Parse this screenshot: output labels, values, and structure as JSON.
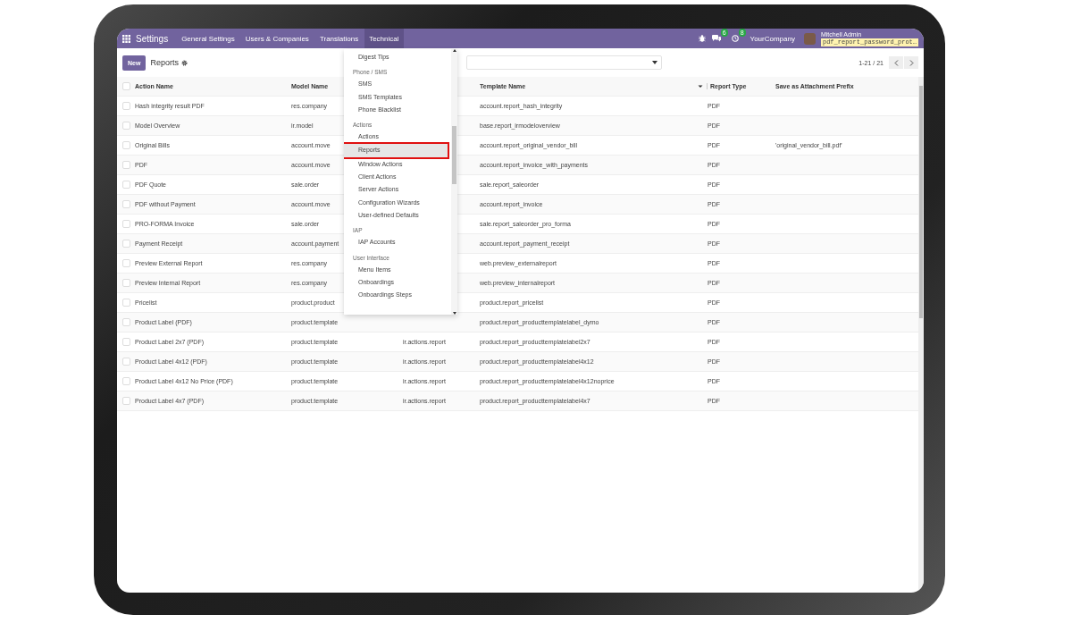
{
  "navbar": {
    "app": "Settings",
    "menus": [
      {
        "label": "General Settings",
        "selected": false
      },
      {
        "label": "Users & Companies",
        "selected": false
      },
      {
        "label": "Translations",
        "selected": false
      },
      {
        "label": "Technical",
        "selected": true
      }
    ],
    "systray": {
      "messages_badge": "6",
      "activities_badge": "8",
      "company": "YourCompany",
      "user": "Mitchell Admin",
      "database": "pdf_report_password_prot…"
    }
  },
  "control_panel": {
    "new_button": "New",
    "title": "Reports",
    "pager": "1-21 / 21"
  },
  "technical_menu": [
    {
      "kind": "item",
      "label": "Digest Tips",
      "selected": false
    },
    {
      "kind": "header",
      "label": "Phone / SMS"
    },
    {
      "kind": "item",
      "label": "SMS",
      "selected": false
    },
    {
      "kind": "item",
      "label": "SMS Templates",
      "selected": false
    },
    {
      "kind": "item",
      "label": "Phone Blacklist",
      "selected": false
    },
    {
      "kind": "header",
      "label": "Actions"
    },
    {
      "kind": "item",
      "label": "Actions",
      "selected": false
    },
    {
      "kind": "item",
      "label": "Reports",
      "selected": true
    },
    {
      "kind": "item",
      "label": "Window Actions",
      "selected": false
    },
    {
      "kind": "item",
      "label": "Client Actions",
      "selected": false
    },
    {
      "kind": "item",
      "label": "Server Actions",
      "selected": false
    },
    {
      "kind": "item",
      "label": "Configuration Wizards",
      "selected": false
    },
    {
      "kind": "item",
      "label": "User-defined Defaults",
      "selected": false
    },
    {
      "kind": "header",
      "label": "IAP"
    },
    {
      "kind": "item",
      "label": "IAP Accounts",
      "selected": false
    },
    {
      "kind": "header",
      "label": "User Interface"
    },
    {
      "kind": "item",
      "label": "Menu Items",
      "selected": false
    },
    {
      "kind": "item",
      "label": "Onboardings",
      "selected": false
    },
    {
      "kind": "item",
      "label": "Onboardings Steps",
      "selected": false
    }
  ],
  "table": {
    "select_all_checked": false,
    "columns": [
      "Action Name",
      "Model Name",
      "Template Name",
      "Report Type",
      "Save as Attachment Prefix"
    ],
    "rows": [
      {
        "checked": false,
        "action_name": "Hash integrity result PDF",
        "model_name": "res.company",
        "template_name": "account.report_hash_integrity",
        "report_type": "PDF"
      },
      {
        "checked": false,
        "action_name": "Model Overview",
        "model_name": "ir.model",
        "template_name": "base.report_irmodeloverview",
        "report_type": "PDF"
      },
      {
        "checked": false,
        "action_name": "Original Bills",
        "model_name": "account.move",
        "template_name": "account.report_original_vendor_bill",
        "report_type": "PDF",
        "attachment_prefix": "'original_vendor_bill.pdf'"
      },
      {
        "checked": false,
        "action_name": "PDF",
        "model_name": "account.move",
        "template_name": "account.report_invoice_with_payments",
        "report_type": "PDF"
      },
      {
        "checked": false,
        "action_name": "PDF Quote",
        "model_name": "sale.order",
        "template_name": "sale.report_saleorder",
        "report_type": "PDF"
      },
      {
        "checked": false,
        "action_name": "PDF without Payment",
        "model_name": "account.move",
        "template_name": "account.report_invoice",
        "report_type": "PDF"
      },
      {
        "checked": false,
        "action_name": "PRO-FORMA Invoice",
        "model_name": "sale.order",
        "template_name": "sale.report_saleorder_pro_forma",
        "report_type": "PDF"
      },
      {
        "checked": false,
        "action_name": "Payment Receipt",
        "model_name": "account.payment",
        "template_name": "account.report_payment_receipt",
        "report_type": "PDF"
      },
      {
        "checked": false,
        "action_name": "Preview External Report",
        "model_name": "res.company",
        "template_name": "web.preview_externalreport",
        "report_type": "PDF"
      },
      {
        "checked": false,
        "action_name": "Preview Internal Report",
        "model_name": "res.company",
        "template_name": "web.preview_internalreport",
        "report_type": "PDF"
      },
      {
        "checked": false,
        "action_name": "Pricelist",
        "model_name": "product.product",
        "template_name": "product.report_pricelist",
        "report_type": "PDF"
      },
      {
        "checked": false,
        "action_name": "Product Label (PDF)",
        "model_name": "product.template",
        "template_name": "product.report_producttemplatelabel_dymo",
        "report_type": "PDF"
      },
      {
        "checked": false,
        "action_name": "Product Label 2x7 (PDF)",
        "model_name": "product.template",
        "column_3": "ir.actions.report",
        "template_name": "product.report_producttemplatelabel2x7",
        "report_type": "PDF"
      },
      {
        "checked": false,
        "action_name": "Product Label 4x12 (PDF)",
        "model_name": "product.template",
        "column_3": "ir.actions.report",
        "template_name": "product.report_producttemplatelabel4x12",
        "report_type": "PDF"
      },
      {
        "checked": false,
        "action_name": "Product Label 4x12 No Price (PDF)",
        "model_name": "product.template",
        "column_3": "ir.actions.report",
        "template_name": "product.report_producttemplatelabel4x12noprice",
        "report_type": "PDF"
      },
      {
        "checked": false,
        "action_name": "Product Label 4x7 (PDF)",
        "model_name": "product.template",
        "column_3": "ir.actions.report",
        "template_name": "product.report_producttemplatelabel4x7",
        "report_type": "PDF"
      }
    ]
  }
}
